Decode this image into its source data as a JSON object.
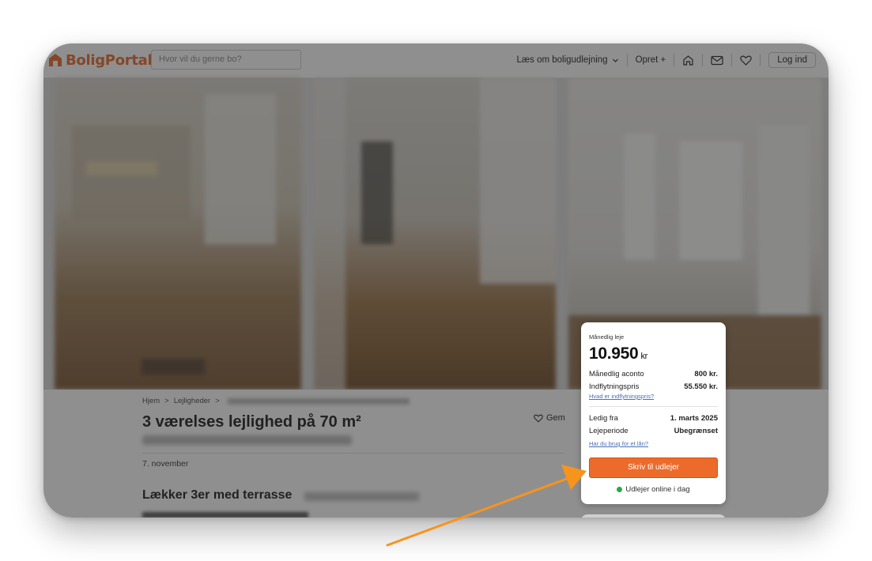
{
  "header": {
    "logo_text": "BoligPortal",
    "search_placeholder": "Hvor vil du gerne bo?",
    "nav_about": "Læs om boligudlejning",
    "nav_create": "Opret +",
    "login_label": "Log ind"
  },
  "breadcrumb": {
    "home": "Hjem",
    "apartments": "Lejligheder",
    "sep": ">"
  },
  "listing": {
    "title": "3 værelses lejlighed på 70 m²",
    "save_label": "Gem",
    "date": "7. november",
    "section_title": "Lækker 3er med terrasse"
  },
  "price_card": {
    "monthly_rent_label": "Månedlig leje",
    "monthly_rent_value": "10.950",
    "currency": "kr",
    "aconto_label": "Månedlig aconto",
    "aconto_value": "800 kr.",
    "move_in_label": "Indflytningspris",
    "move_in_value": "55.550 kr.",
    "move_in_link": "Hvad er indflytningspris?",
    "available_label": "Ledig fra",
    "available_value": "1. marts 2025",
    "period_label": "Lejeperiode",
    "period_value": "Ubegrænset",
    "loan_link": "Har du brug for et lån?",
    "cta_label": "Skriv til udlejer",
    "online_status": "Udlejer online i dag"
  },
  "colors": {
    "brand": "#e8692b",
    "cta": "#ec6b2a",
    "online": "#2aa84a",
    "annotation_arrow": "#f7941d"
  }
}
